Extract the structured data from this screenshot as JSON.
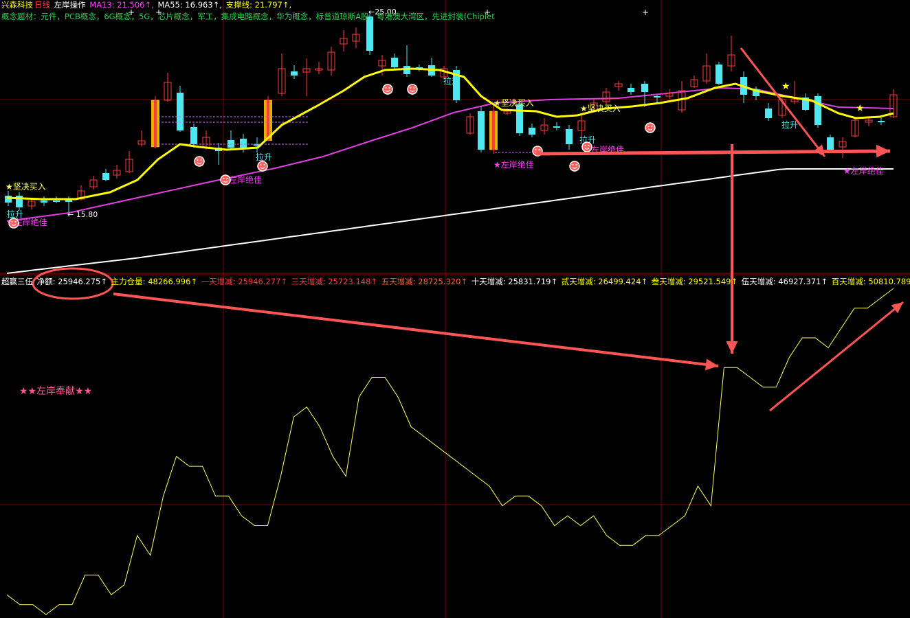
{
  "header": {
    "stock_name": "兴森科技",
    "period": "日线",
    "indicator_name": "左岸操作",
    "ma13": "MA13: 21.506↑,",
    "ma55": "MA55: 16.963↑,",
    "support": "支撑线: 21.797↑,",
    "concepts": "概念题材：元件，PCB概念，6G概念，5G，芯片概念，军工，集成电路概念，华为概念，标普道琼斯A股，粤港澳大湾区，先进封装(Chiplet"
  },
  "sub_header": {
    "indicator_name": "超赢三伍",
    "net": "净额: 25946.275↑",
    "main_position": "主力仓量: 48266.996↑",
    "d1": "一天增减: 25946.277↑",
    "d3": "三天增减: 25723.148↑",
    "d5": "五天增减: 28725.320↑",
    "d10": "十天增减: 25831.719↑",
    "d20": "贰天增减: 26499.424↑",
    "d30": "叁天增减: 29521.549↑",
    "d50": "伍天增减: 46927.371↑",
    "d100": "百天增减: 50810.789"
  },
  "labels": {
    "buy": "坚决买入",
    "left_bank": "左岸绝佳",
    "pull_up": "拉升",
    "low_price": "15.80",
    "high_price": "25.00",
    "contribution": "★★左岸奉献★★"
  },
  "colors": {
    "up": "#ff3b3b",
    "down": "#4fe8f0",
    "ma13": "#ffff00",
    "ma55": "#e040e0",
    "support": "#ffffff",
    "indicator_line": "#ffff66",
    "grid": "#800000",
    "arrow": "#ff5555"
  },
  "chart_data": [
    {
      "type": "candlestick",
      "title": "兴森科技 日线",
      "series": [
        {
          "name": "MA13",
          "values": [
            21.506
          ]
        },
        {
          "name": "MA55",
          "values": [
            16.963
          ]
        },
        {
          "name": "支撑线",
          "values": [
            21.797
          ]
        }
      ],
      "ylim": [
        15.8,
        25.0
      ],
      "annotations": [
        "坚决买入",
        "左岸绝佳",
        "拉升"
      ]
    },
    {
      "type": "line",
      "title": "超赢三伍",
      "series": [
        {
          "name": "净额",
          "values": [
            2,
            1,
            1,
            0,
            1,
            1,
            4,
            4,
            2,
            3,
            8,
            6,
            12,
            16,
            15,
            15,
            12,
            12,
            10,
            9,
            9,
            14,
            20,
            21,
            19,
            16,
            14,
            22,
            24,
            24,
            22,
            19,
            18,
            17,
            16,
            15,
            14,
            13,
            11,
            12,
            12,
            11,
            9,
            10,
            9,
            10,
            8,
            7,
            7,
            8,
            8,
            9,
            10,
            13,
            11,
            25,
            25,
            24,
            23,
            23,
            26,
            28,
            28,
            27,
            29,
            31,
            31,
            32,
            33
          ]
        }
      ]
    }
  ]
}
